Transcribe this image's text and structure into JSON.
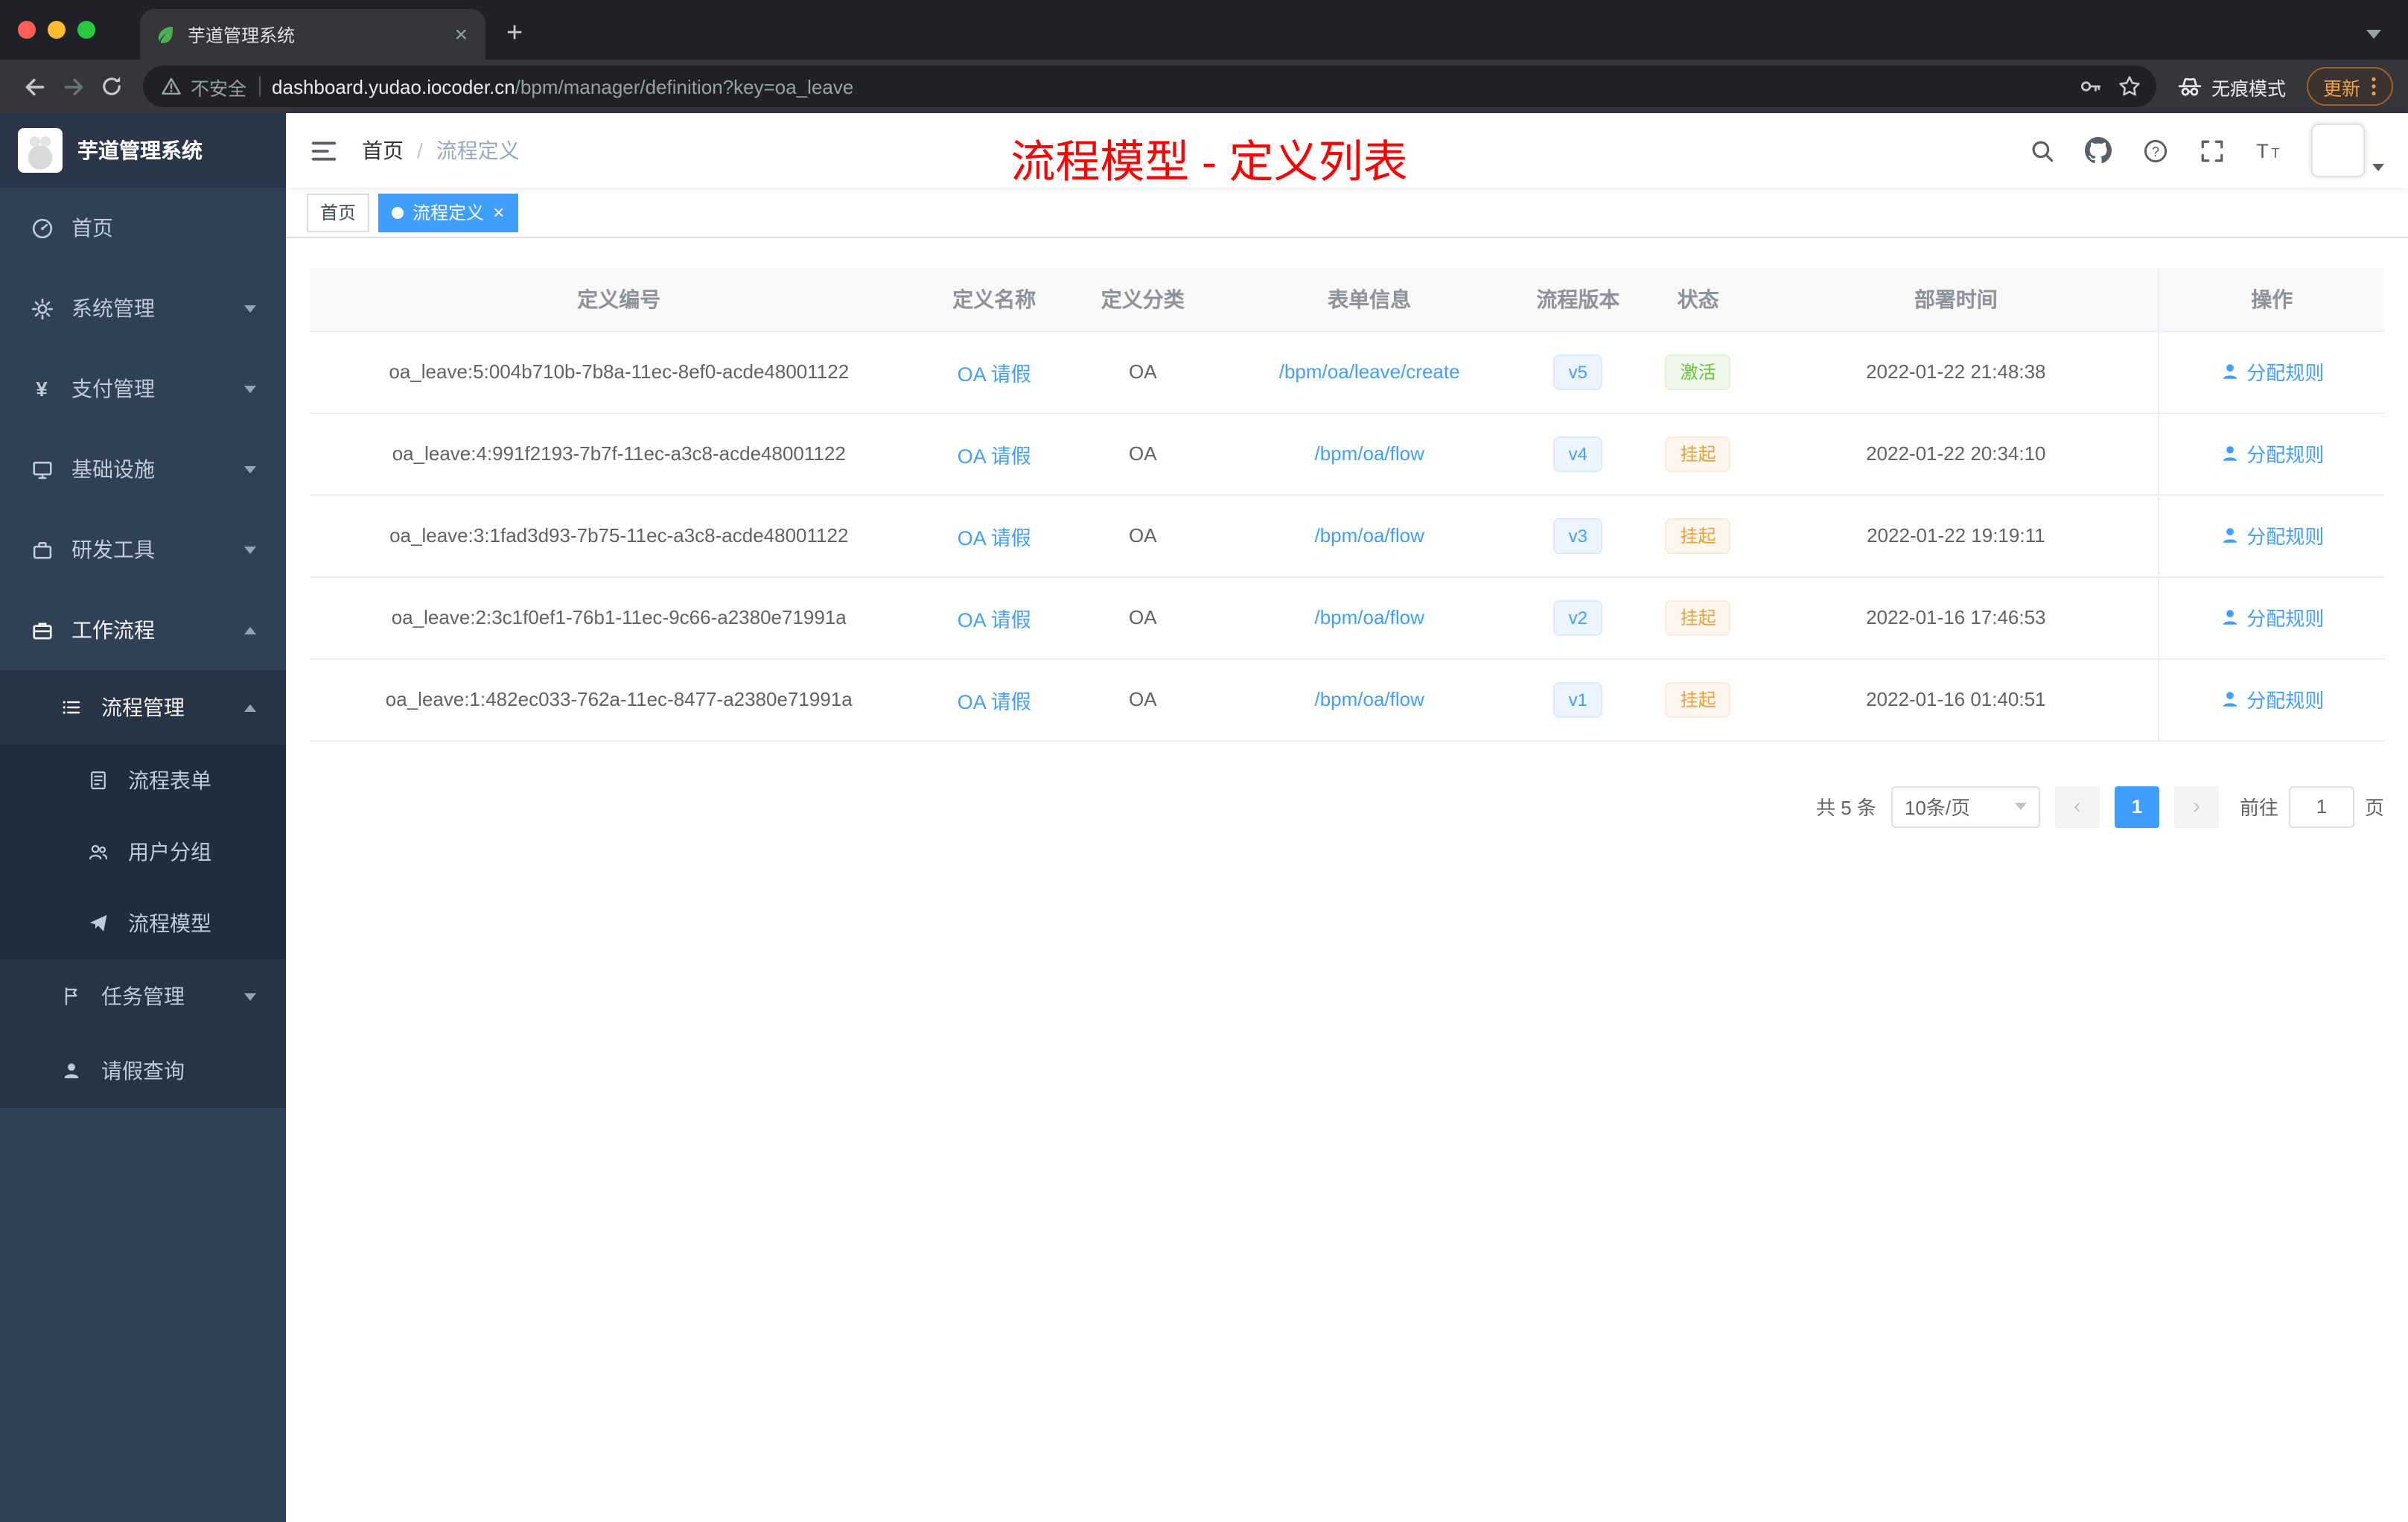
{
  "browser": {
    "tab_title": "芋道管理系统",
    "close_tab": "×",
    "new_tab": "+",
    "security": "不安全",
    "url_host": "dashboard.yudao.iocoder.cn",
    "url_path": "/bpm/manager/definition?key=oa_leave",
    "incognito": "无痕模式",
    "update": "更新"
  },
  "sidebar": {
    "title": "芋道管理系统",
    "menu": [
      {
        "label": "首页"
      },
      {
        "label": "系统管理"
      },
      {
        "label": "支付管理"
      },
      {
        "label": "基础设施"
      },
      {
        "label": "研发工具"
      },
      {
        "label": "工作流程"
      }
    ],
    "process_manage": "流程管理",
    "process_children": [
      "流程表单",
      "用户分组",
      "流程模型"
    ],
    "task_manage": "任务管理",
    "leave_query": "请假查询"
  },
  "navbar": {
    "breadcrumb_home": "首页",
    "breadcrumb_sep": "/",
    "breadcrumb_current": "流程定义",
    "annotation": "流程模型 - 定义列表"
  },
  "tags": {
    "home": "首页",
    "active": "流程定义",
    "close": "×"
  },
  "table": {
    "columns": [
      "定义编号",
      "定义名称",
      "定义分类",
      "表单信息",
      "流程版本",
      "状态",
      "部署时间",
      "操作"
    ],
    "rows": [
      {
        "id": "oa_leave:5:004b710b-7b8a-11ec-8ef0-acde48001122",
        "name": "OA 请假",
        "category": "OA",
        "form": "/bpm/oa/leave/create",
        "version": "v5",
        "status": "激活",
        "time": "2022-01-22 21:48:38",
        "action": "分配规则"
      },
      {
        "id": "oa_leave:4:991f2193-7b7f-11ec-a3c8-acde48001122",
        "name": "OA 请假",
        "category": "OA",
        "form": "/bpm/oa/flow",
        "version": "v4",
        "status": "挂起",
        "time": "2022-01-22 20:34:10",
        "action": "分配规则"
      },
      {
        "id": "oa_leave:3:1fad3d93-7b75-11ec-a3c8-acde48001122",
        "name": "OA 请假",
        "category": "OA",
        "form": "/bpm/oa/flow",
        "version": "v3",
        "status": "挂起",
        "time": "2022-01-22 19:19:11",
        "action": "分配规则"
      },
      {
        "id": "oa_leave:2:3c1f0ef1-76b1-11ec-9c66-a2380e71991a",
        "name": "OA 请假",
        "category": "OA",
        "form": "/bpm/oa/flow",
        "version": "v2",
        "status": "挂起",
        "time": "2022-01-16 17:46:53",
        "action": "分配规则"
      },
      {
        "id": "oa_leave:1:482ec033-762a-11ec-8477-a2380e71991a",
        "name": "OA 请假",
        "category": "OA",
        "form": "/bpm/oa/flow",
        "version": "v1",
        "status": "挂起",
        "time": "2022-01-16 01:40:51",
        "action": "分配规则"
      }
    ]
  },
  "pagination": {
    "total": "共 5 条",
    "page_size": "10条/页",
    "prev": "‹",
    "page": "1",
    "next": "›",
    "goto": "前往",
    "goto_value": "1",
    "unit": "页"
  },
  "colors": {
    "accent": "#409eff",
    "success": "#67c23a",
    "warning": "#e6a23c",
    "annotation": "#fe0000",
    "sidebar_bg": "#304156"
  }
}
